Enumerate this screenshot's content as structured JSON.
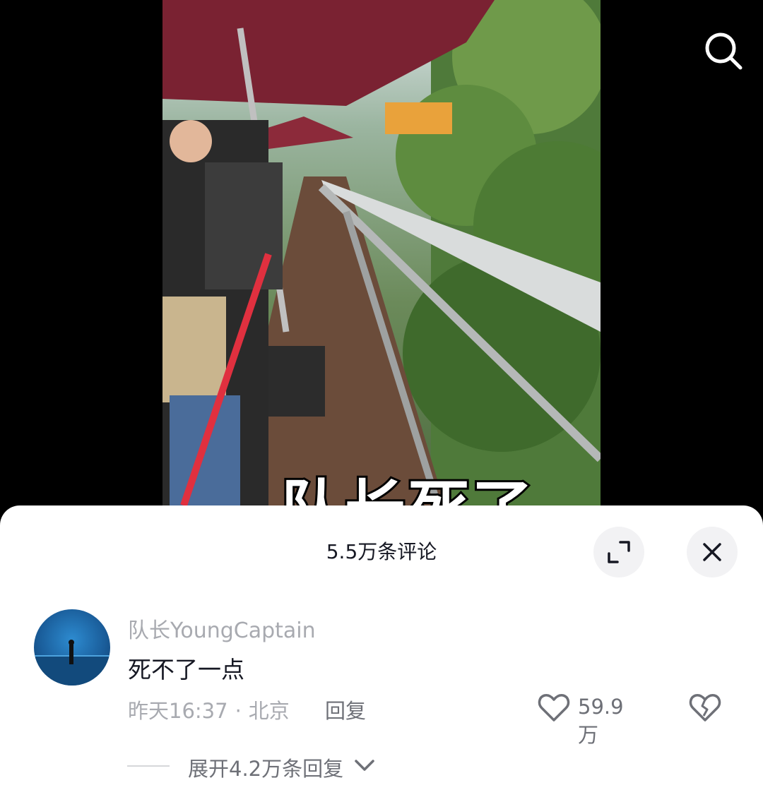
{
  "video": {
    "caption": "队长死了",
    "search_icon": "search-icon"
  },
  "comments_panel": {
    "title": "5.5万条评论",
    "expand_icon": "expand-icon",
    "close_icon": "close-icon"
  },
  "comment": {
    "username": "队长YoungCaptain",
    "text": "死不了一点",
    "time": "昨天16:37",
    "separator": "·",
    "location": "北京",
    "reply_label": "回复",
    "like_count": "59.9万",
    "expand_replies_label": "展开4.2万条回复",
    "icons": {
      "like": "heart-icon",
      "dislike": "broken-heart-icon",
      "expand": "chevron-down-icon"
    }
  },
  "colors": {
    "umbrella": "#7a2232",
    "secondary_text": "#a8aab0",
    "primary_text": "#161823"
  }
}
